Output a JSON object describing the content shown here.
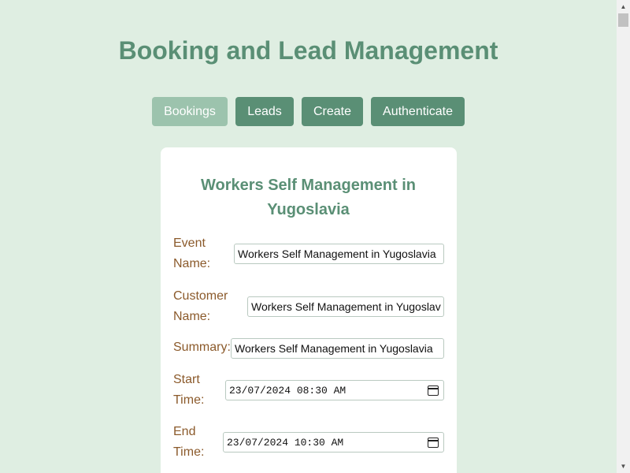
{
  "page": {
    "title": "Booking and Lead Management"
  },
  "nav": {
    "items": [
      {
        "label": "Bookings",
        "active": true
      },
      {
        "label": "Leads",
        "active": false
      },
      {
        "label": "Create",
        "active": false
      },
      {
        "label": "Authenticate",
        "active": false
      }
    ]
  },
  "booking": {
    "title": "Workers Self Management in Yugoslavia",
    "fields": {
      "event_name": {
        "label": "Event Name:",
        "value": "Workers Self Management in Yugoslavia"
      },
      "customer_name": {
        "label": "Customer Name:",
        "value": "Workers Self Management in Yugoslav"
      },
      "summary": {
        "label": "Summary:",
        "value": "Workers Self Management in Yugoslavia"
      },
      "start_time": {
        "label": "Start Time:",
        "value": "23/07/2024 08:30 AM"
      },
      "end_time": {
        "label": "End Time:",
        "value": "23/07/2024 10:30 AM"
      }
    }
  },
  "icons": {
    "calendar": "calendar-icon"
  },
  "colors": {
    "background": "#dfeee2",
    "accent": "#5a8f75",
    "accent_light": "#9cc3ad",
    "label": "#8b5a2b"
  }
}
